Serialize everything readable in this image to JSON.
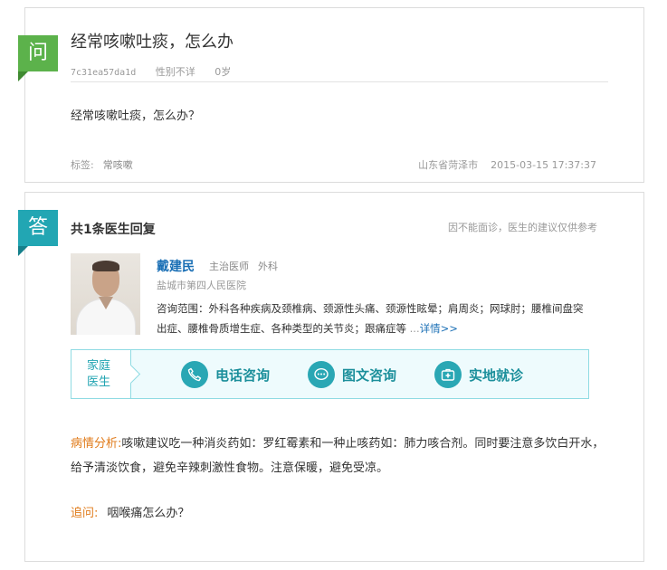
{
  "question": {
    "badge": "问",
    "title": "经常咳嗽吐痰，怎么办",
    "user_id": "7c31ea57da1d",
    "gender": "性别不详",
    "age": "0岁",
    "body": "经常咳嗽吐痰，怎么办？",
    "tags_label": "标签:",
    "tag": "常咳嗽",
    "location": "山东省菏泽市",
    "time": "2015-03-15 17:37:37"
  },
  "answer": {
    "badge": "答",
    "count_label": "共1条医生回复",
    "disclaimer": "因不能面诊，医生的建议仅供参考",
    "doctor": {
      "name": "戴建民",
      "position": "主治医师",
      "department": "外科",
      "hospital": "盐城市第四人民医院",
      "scope": "咨询范围：外科各种疾病及颈椎病、颈源性头痛、颈源性眩晕；肩周炎；网球肘；腰椎间盘突出症、腰椎骨质增生症、各种类型的关节炎；跟痛症等",
      "ellipsis": "...",
      "detail_link": "详情>>"
    },
    "services": {
      "label_line1": "家庭",
      "label_line2": "医生",
      "phone": "电话咨询",
      "text": "图文咨询",
      "visit": "实地就诊"
    },
    "analysis_label": "病情分析:",
    "analysis": "咳嗽建议吃一种消炎药如：罗红霉素和一种止咳药如：肺力咳合剂。同时要注意多饮白开水，给予清淡饮食，避免辛辣刺激性食物。注意保暖，避免受凉。",
    "followup_label": "追问:",
    "followup": "咽喉痛怎么办？"
  },
  "colors": {
    "question_badge": "#5cb24b",
    "answer_badge": "#22a6b3",
    "doctor_name": "#1a6fb5",
    "highlight_label": "#e07b1a"
  }
}
